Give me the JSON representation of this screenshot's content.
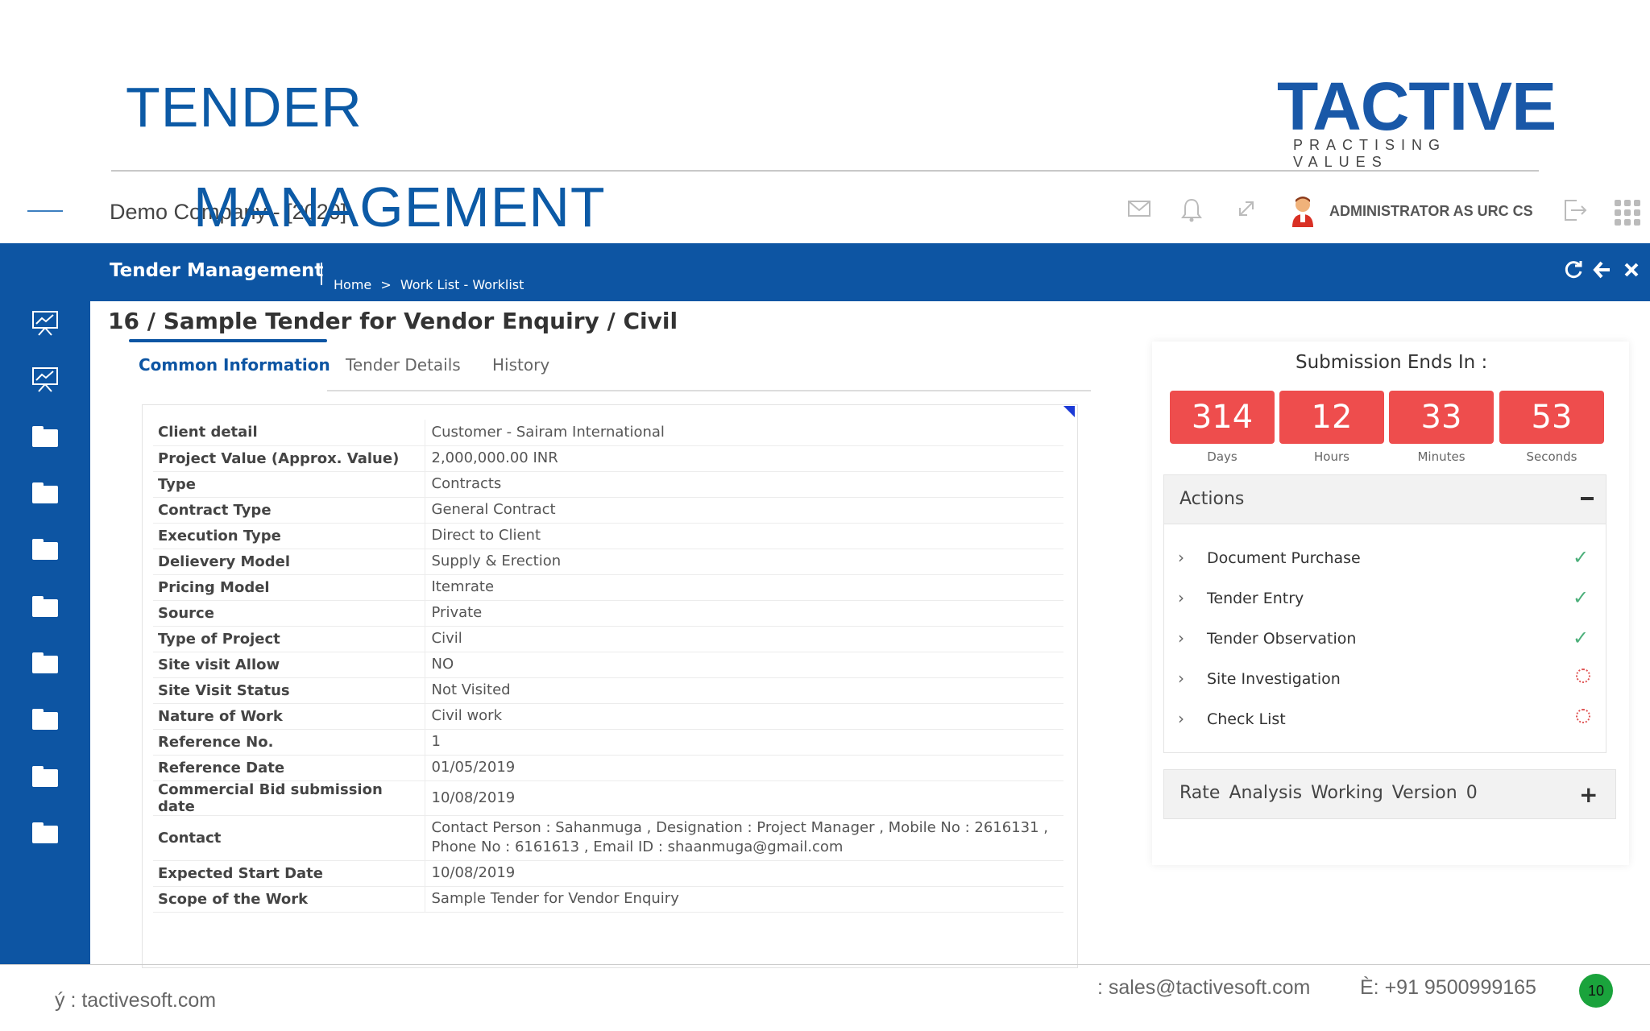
{
  "slide": {
    "title_line1": "TENDER",
    "title_line2": "MANAGEMENT",
    "logo_text": "TACTIVE",
    "logo_tagline": "PRACTISING VALUES"
  },
  "topbar": {
    "company": "Demo Company - [2020]",
    "user": "ADMINISTRATOR AS URC CS",
    "icons": [
      "mail-icon",
      "bell-icon",
      "expand-icon",
      "user-avatar",
      "logout-icon",
      "apps-grid-icon"
    ]
  },
  "module_bar": {
    "title": "Tender Management",
    "breadcrumb": [
      "Home",
      ">",
      "Work List - Worklist"
    ],
    "icons": [
      "refresh-icon",
      "back-arrow-icon",
      "close-icon"
    ]
  },
  "page": {
    "heading": "16 / Sample Tender for Vendor Enquiry / Civil"
  },
  "tabs": [
    {
      "label": "Common Information",
      "active": true
    },
    {
      "label": "Tender Details",
      "active": false
    },
    {
      "label": "History",
      "active": false
    }
  ],
  "details": [
    {
      "label": "Client detail",
      "value": "Customer - Sairam International"
    },
    {
      "label": "Project Value (Approx. Value)",
      "value": "2,000,000.00 INR"
    },
    {
      "label": "Type",
      "value": "Contracts"
    },
    {
      "label": "Contract Type",
      "value": "General Contract"
    },
    {
      "label": "Execution Type",
      "value": "Direct to Client"
    },
    {
      "label": "Delievery Model",
      "value": "Supply & Erection"
    },
    {
      "label": "Pricing Model",
      "value": "Itemrate"
    },
    {
      "label": "Source",
      "value": "Private"
    },
    {
      "label": "Type of Project",
      "value": "Civil"
    },
    {
      "label": "Site visit Allow",
      "value": "NO"
    },
    {
      "label": "Site Visit Status",
      "value": "Not Visited"
    },
    {
      "label": "Nature of Work",
      "value": "Civil work"
    },
    {
      "label": "Reference No.",
      "value": "1"
    },
    {
      "label": "Reference Date",
      "value": "01/05/2019"
    },
    {
      "label": "Commercial Bid submission date",
      "value": "10/08/2019"
    },
    {
      "label": "Contact",
      "value": "Contact Person : Sahanmuga , Designation : Project Manager , Mobile No : 2616131 , Phone No : 6161613 , Email ID : shaanmuga@gmail.com"
    },
    {
      "label": "Expected Start Date",
      "value": "10/08/2019"
    },
    {
      "label": "Scope of the Work",
      "value": "Sample Tender for Vendor Enquiry"
    }
  ],
  "countdown": {
    "title": "Submission Ends In :",
    "units": [
      {
        "value": "314",
        "label": "Days"
      },
      {
        "value": "12",
        "label": "Hours"
      },
      {
        "value": "33",
        "label": "Minutes"
      },
      {
        "value": "53",
        "label": "Seconds"
      }
    ],
    "box_color": "#ee4d4d"
  },
  "actions": {
    "title": "Actions",
    "items": [
      {
        "label": "Document Purchase",
        "status": "done"
      },
      {
        "label": "Tender Entry",
        "status": "done"
      },
      {
        "label": "Tender Observation",
        "status": "done"
      },
      {
        "label": "Site Investigation",
        "status": "pending"
      },
      {
        "label": "Check List",
        "status": "pending"
      }
    ]
  },
  "rate_analysis": {
    "title": "Rate Analysis Working Version 0"
  },
  "footer": {
    "website": "ý : tactivesoft.com",
    "email": ": sales@tactivesoft.com",
    "phone": "È: +91 9500999165",
    "page_number": "10"
  },
  "colors": {
    "brand_blue": "#0d55a3",
    "title_blue": "#0c5aa6",
    "success_green": "#4caf7a",
    "page_badge": "#1aa33c"
  }
}
